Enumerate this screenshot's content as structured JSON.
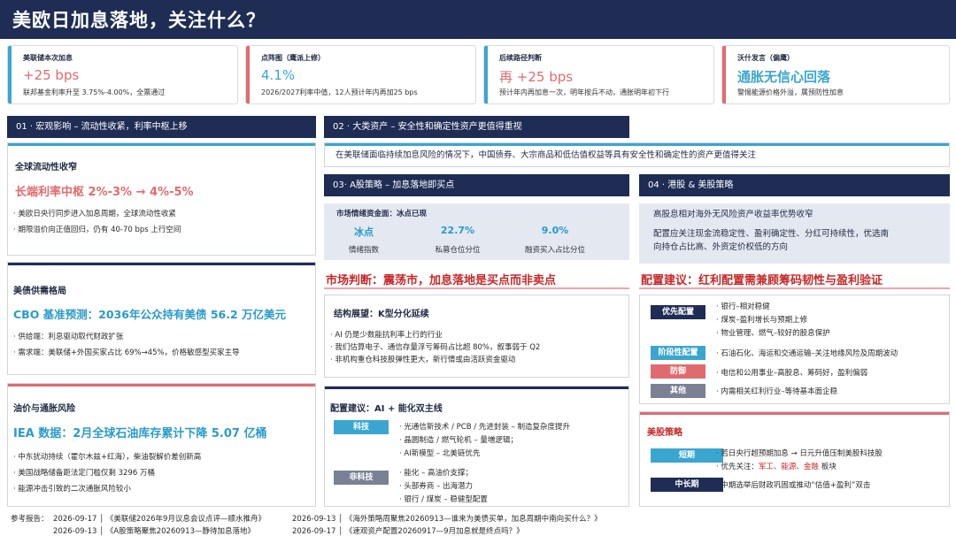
{
  "title": "美欧日加息落地，关注什么？",
  "kpis": [
    {
      "label": "美联储本次加息",
      "value": "+25 bps",
      "desc": "联邦基金利率升至 3.75%-4.00%，全票通过"
    },
    {
      "label": "点阵图（鹰派上修）",
      "value": "4.1%",
      "desc": "2026/2027利率中值，12人预计年内再加25 bps"
    },
    {
      "label": "后续路径判断",
      "value": "再 +25 bps",
      "desc": "预计年内再加息一次，明年按兵不动，通胀明年初下行"
    },
    {
      "label": "沃什发言（偏鹰）",
      "value": "通胀无信心回落",
      "desc": "警惕能源价格外溢，属预防性加息"
    }
  ],
  "colors": {
    "navy": "#1f2d55",
    "red": "#e06b6e",
    "teal": "#3aa6d0",
    "accent_red": "#c62828"
  },
  "sec01": {
    "header": "01 · 宏观影响 – 流动性收紧，利率中枢上移",
    "card1": {
      "title": "全球流动性收窄",
      "big": "长端利率中枢 2%-3% → 4%-5%",
      "bullets": [
        "· 美欧日央行同步进入加息周期，全球流动性收紧",
        "· 期限溢价向正值回归，仍有 40-70 bps 上行空间"
      ]
    },
    "card2": {
      "title": "美债供需格局",
      "big": "CBO 基准预测：2036年公众持有美债 56.2 万亿美元",
      "bullets": [
        "· 供给端：利息驱动取代财政扩张",
        "· 需求端：美联储+外国买家占比 69%→45%，价格敏感型买家主导"
      ]
    },
    "card3": {
      "title": "油价与通胀风险",
      "big": "IEA 数据：2月全球石油库存累计下降 5.07 亿桶",
      "bullets": [
        "· 中东扰动持续（霍尔木兹+红海），柴油裂解价差创新高",
        "· 美国战略储备距法定门槛仅剩 3296 万桶",
        "· 能源冲击引致的二次通胀风险较小"
      ]
    }
  },
  "sec02": {
    "header": "02 · 大类资产 – 安全性和确定性资产更值得重视",
    "text": "在美联储面临持续加息风险的情况下，中国债券、大宗商品和低估值权益等具有安全性和确定性的资产更值得关注"
  },
  "sec03": {
    "header": "03· A股策略 – 加息落地即买点",
    "sentiment": {
      "title": "市场情绪资金面：冰点已现",
      "stats": [
        {
          "value": "冰点",
          "label": "情绪指数"
        },
        {
          "value": "22.7%",
          "label": "私募仓位分位"
        },
        {
          "value": "9.0%",
          "label": "融资买入占比分位"
        }
      ]
    },
    "judgement": "市场判断：震荡市，加息落地是买点而非卖点",
    "outlook": {
      "title": "结构展望：K型分化延续",
      "bullets": [
        "· AI 仍是少数能抗利率上行的行业",
        "· 我们估算电子、通信存量浮亏筹码占比超 80%，叙事弱于 Q2",
        "· 非机构重仓科技股弹性更大，新行情或由活跃资金驱动"
      ]
    },
    "config": {
      "title": "配置建议：AI + 能化双主线",
      "groups": [
        {
          "tag": "科技",
          "items": [
            "· 光通信新技术 / PCB / 先进封装 – 制造复杂度提升",
            "· 晶圆制造 / 燃气轮机 – 量増逻辑；",
            "· AI新模型 – 北美链优先"
          ]
        },
        {
          "tag": "非科技",
          "items": [
            "· 能化 – 高油价支撑；",
            "· 头部券商 – 出海潜力",
            "· 银行 / 煤炭 – 稳健型配置"
          ]
        }
      ]
    }
  },
  "sec04": {
    "header": "04 · 港股 & 美股策略",
    "intro": [
      "高股息相对海外无风险资产收益率优势收窄",
      "配置应关注现金流稳定性、盈利确定性、分红可持续性，优选南",
      "向持仓占比高、外资定价权低的方向"
    ],
    "advice": "配置建议：红利配置需兼顾筹码韧性与盈利验证",
    "hk": [
      {
        "tag": "优先配置",
        "items": [
          "· 银行–相对稳健",
          "· 煤炭–盈利增长与预期上修",
          "· 物业管理、燃气–较好的股息保护"
        ]
      },
      {
        "tag": "阶段性配置",
        "items": [
          "· 石油石化、海运和交通运输–关注地缘风险及周期波动"
        ]
      },
      {
        "tag": "防御",
        "items": [
          "· 电信和公用事业–高股息、筹码好，盈利偏弱"
        ]
      },
      {
        "tag": "其他",
        "items": [
          "· 内需相关红利行业–等待基本面企稳"
        ]
      }
    ],
    "us": {
      "title": "美股策略",
      "short_tag": "短期",
      "short_items": [
        "· 若日央行超预期加息 → 日元升值压制美股科技股",
        "· 优先关注：",
        "军工、能源、金融",
        "板块"
      ],
      "mid_tag": "中长期",
      "mid_items": [
        "· 中期选举后财政巩固或推动“估值+盈利”双击"
      ]
    }
  },
  "refs": {
    "label": "参考报告：",
    "items": [
      "2026-09-17 │ 《美联储2026年9月议息会议点评—顺水推舟》",
      "2026-09-13 │ 《海外策略周聚焦20260913—谁来为美债买单，加息周期中南向买什么？》",
      "2026-09-13 │ 《A股策略聚焦20260913—静待加息落地》",
      "2026-09-17 │ 《速观资产配置20260917—9月加息就是终点吗？》"
    ]
  }
}
